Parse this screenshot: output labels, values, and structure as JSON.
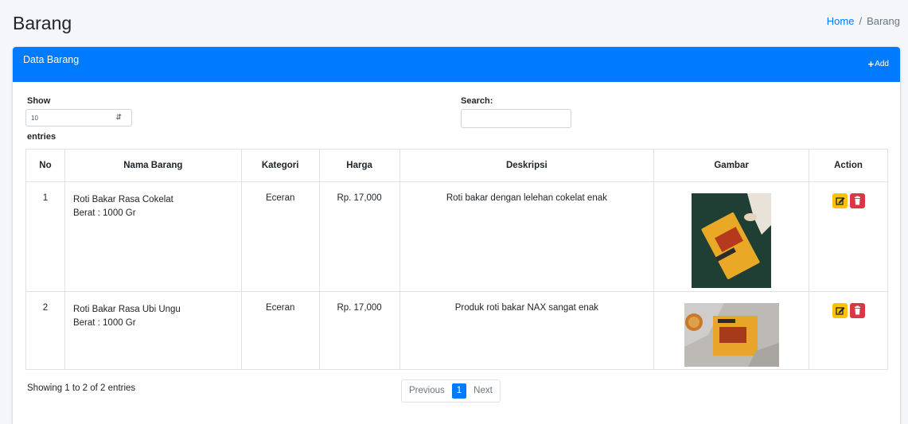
{
  "header": {
    "title": "Barang",
    "breadcrumb": {
      "home": "Home",
      "separator": "/",
      "current": "Barang"
    }
  },
  "card": {
    "title": "Data Barang",
    "add_label": "Add"
  },
  "controls": {
    "show_label": "Show",
    "page_length": "10",
    "entries_label": "entries",
    "search_label": "Search:",
    "search_value": ""
  },
  "table": {
    "columns": [
      "No",
      "Nama Barang",
      "Kategori",
      "Harga",
      "Deskripsi",
      "Gambar",
      "Action"
    ],
    "rows": [
      {
        "no": "1",
        "nama": "Roti Bakar Rasa Cokelat",
        "berat": "Berat : 1000 Gr",
        "kategori": "Eceran",
        "harga": "Rp. 17,000",
        "deskripsi": "Roti bakar dengan lelehan cokelat enak",
        "image_icon": "product-photo-dark-green"
      },
      {
        "no": "2",
        "nama": "Roti Bakar Rasa Ubi Ungu",
        "berat": "Berat : 1000 Gr",
        "kategori": "Eceran",
        "harga": "Rp. 17,000",
        "deskripsi": "Produk roti bakar NAX sangat enak",
        "image_icon": "product-photo-gray"
      }
    ]
  },
  "footer": {
    "info": "Showing 1 to 2 of 2 entries",
    "pagination": {
      "previous": "Previous",
      "current": "1",
      "next": "Next"
    }
  },
  "colors": {
    "primary": "#007bff",
    "warning": "#ffc107",
    "danger": "#dc3545",
    "background": "#f4f6f9"
  }
}
